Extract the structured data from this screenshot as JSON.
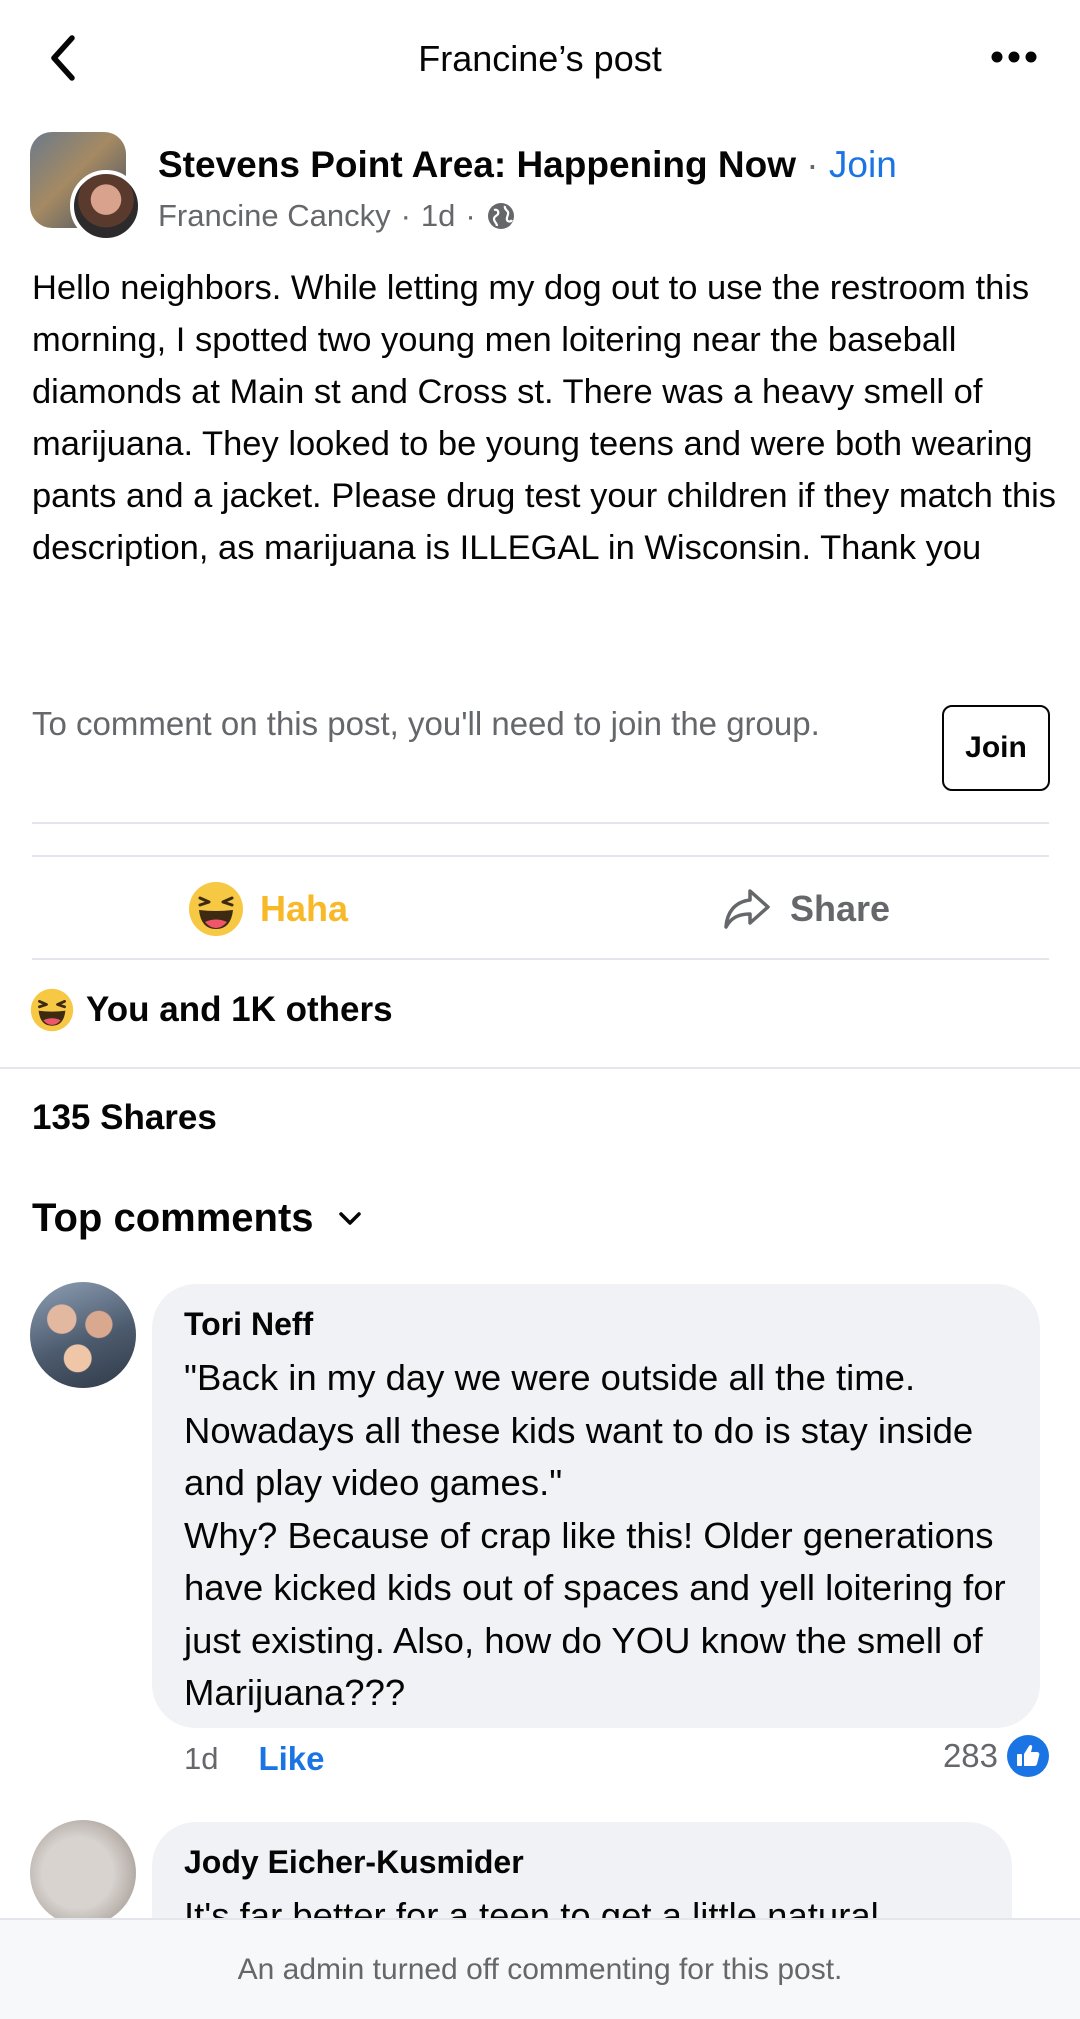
{
  "topbar": {
    "title": "Francine’s post",
    "back_icon": "chevron-left-icon",
    "more_icon": "more-horizontal-icon"
  },
  "post": {
    "group_name": "Stevens Point Area: Happening Now",
    "separator": "·",
    "join_link": "Join",
    "author": "Francine Cancky",
    "time": "1d",
    "meta_sep": "·",
    "privacy_icon": "globe-icon",
    "body": "Hello neighbors. While letting my dog out to use the restroom this morning, I spotted two young men loitering near the baseball diamonds at Main st and Cross st. There was a heavy smell of marijuana. They looked to be young teens and were both wearing pants and a jacket. Please drug test your children if they match this description, as marijuana is ILLEGAL in Wisconsin. Thank you",
    "join_prompt": "To comment on this post, you'll need to join the group.",
    "join_button": "Join"
  },
  "actions": {
    "reaction_label": "Haha",
    "reaction_icon": "haha-emoji-icon",
    "share_label": "Share",
    "share_icon": "share-arrow-icon"
  },
  "reactions": {
    "summary": "You and 1K others",
    "icon": "haha-emoji-icon"
  },
  "shares": {
    "label": "135 Shares"
  },
  "comments_section": {
    "sort_label": "Top comments",
    "sort_icon": "chevron-down-icon",
    "comments": [
      {
        "author": "Tori Neff",
        "text": "\"Back in my day we were outside all the time. Nowadays all these kids want to do is stay inside and play video games.\"\nWhy? Because of crap like this! Older generations have kicked kids out of spaces and yell loitering for just existing. Also, how do YOU know the smell of Marijuana???",
        "time": "1d",
        "like_label": "Like",
        "like_count": "283",
        "like_icon": "thumbs-up-icon"
      },
      {
        "author": "Jody Eicher-Kusmider",
        "text": "It's far better for a teen to get a little natural"
      }
    ]
  },
  "footer": {
    "message": "An admin turned off commenting for this post."
  },
  "colors": {
    "link_blue": "#1b74e4",
    "haha_yellow": "#f7b928",
    "secondary_text": "#65676b",
    "bubble_bg": "#f0f2f5"
  }
}
